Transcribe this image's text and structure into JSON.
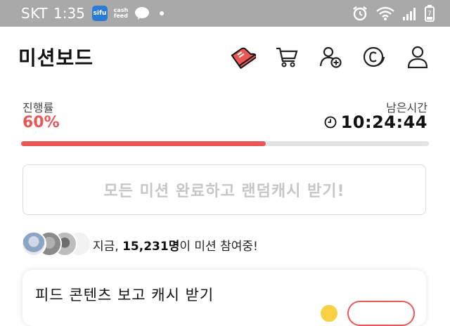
{
  "status_bar": {
    "carrier": "SKT",
    "time": "1:35",
    "apps": [
      {
        "name": "samsung-app-icon",
        "label": "sifu"
      },
      {
        "name": "cashfeed-icon",
        "label_line1": "cash",
        "label_line2": "feed"
      },
      {
        "name": "kakaotalk-icon",
        "label": "TALK"
      }
    ],
    "battery_level": "7"
  },
  "header": {
    "title": "미션보드",
    "icons": [
      "shoe-icon",
      "cart-icon",
      "add-friend-icon",
      "cash-coin-icon",
      "profile-icon"
    ]
  },
  "progress": {
    "label": "진행률",
    "percent_text": "60%",
    "percent_value": 60,
    "remaining_label": "남은시간",
    "remaining_time": "10:24:44",
    "accent_color": "#e95757"
  },
  "reward_button": {
    "label": "모든 미션 완료하고 랜덤캐시 받기!"
  },
  "participants": {
    "prefix": "지금, ",
    "count": "15,231명",
    "suffix": "이 미션 참여중!"
  },
  "mission": {
    "title": "피드 콘텐츠 보고 캐시 받기"
  }
}
